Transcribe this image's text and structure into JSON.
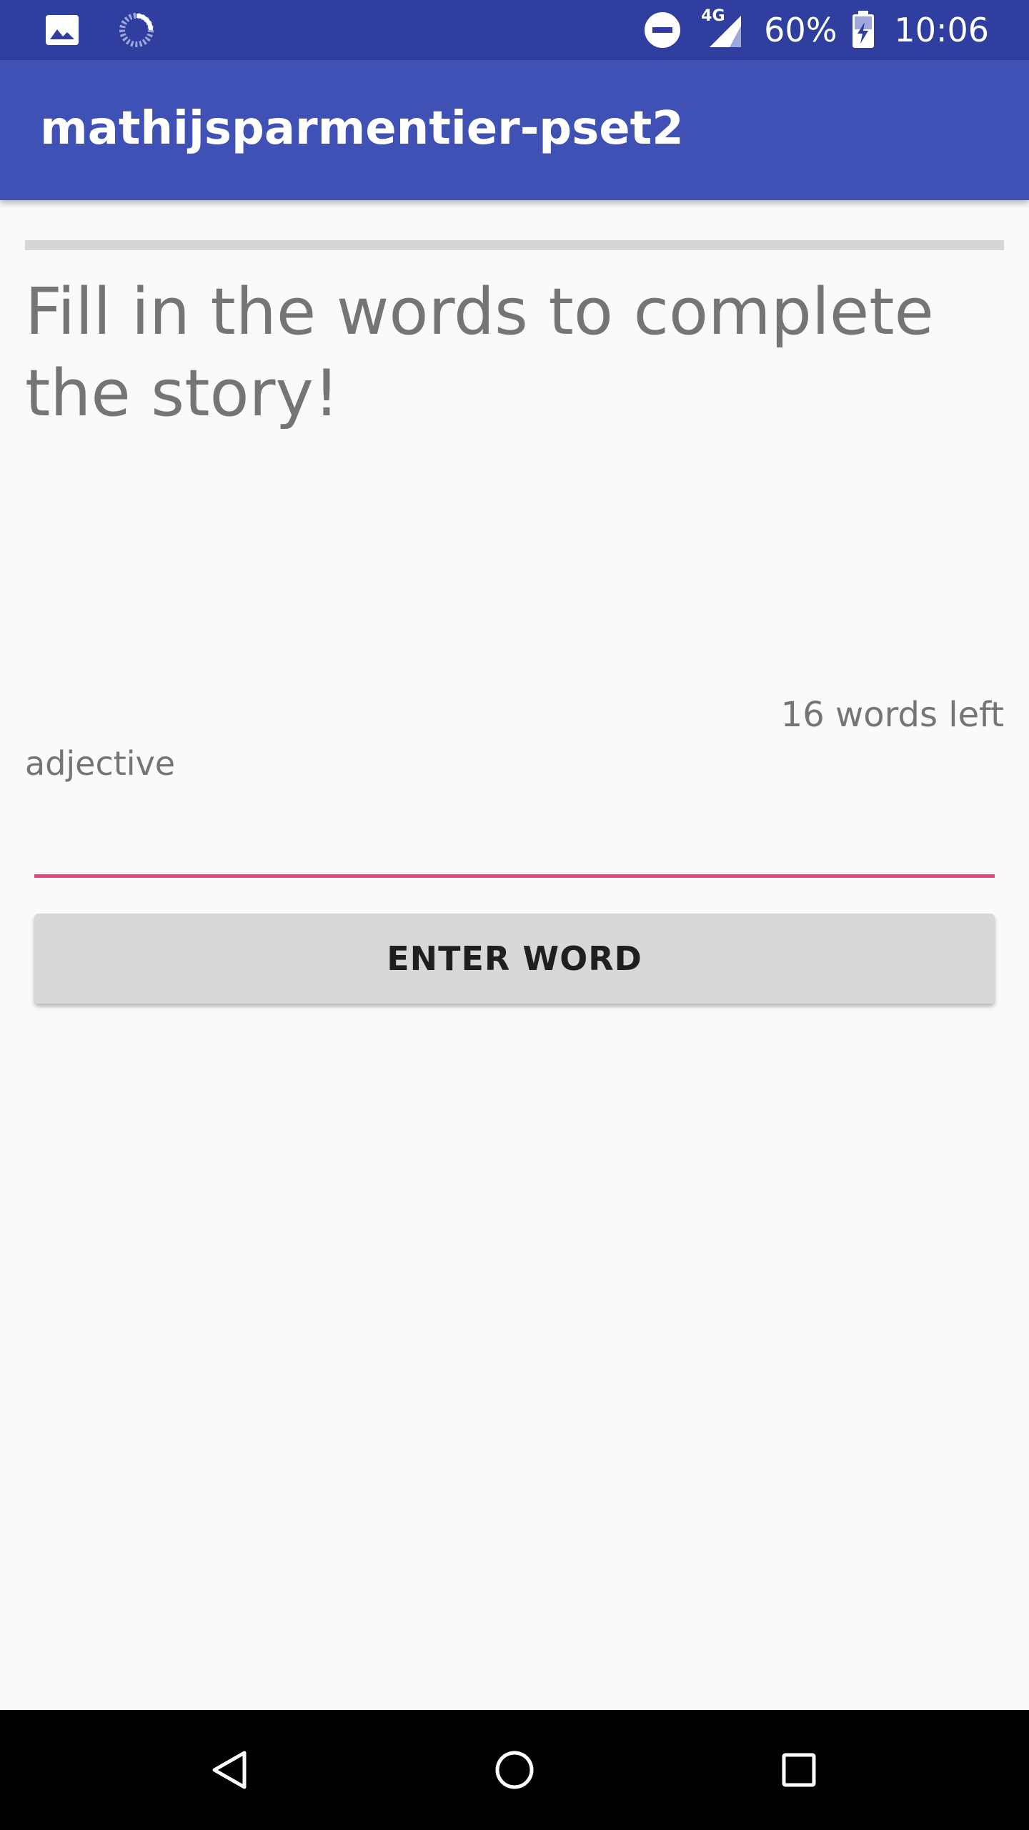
{
  "status_bar": {
    "battery_percent": "60%",
    "time": "10:06",
    "network_label": "4G",
    "icons": [
      "image-icon",
      "sync-icon",
      "do-not-disturb-icon",
      "signal-4g-icon",
      "battery-charging-icon"
    ],
    "background_color": "#303f9f"
  },
  "app_bar": {
    "title": "mathijsparmentier-pset2",
    "background_color": "#3f51b5"
  },
  "progress": {
    "value": 0
  },
  "main": {
    "heading": "Fill in the words to complete the story!",
    "words_left": "16 words left",
    "hint": "adjective",
    "input": {
      "value": "",
      "placeholder": ""
    },
    "enter_button_label": "ENTER WORD",
    "accent_color": "#e9457e"
  },
  "nav_bar": {
    "icons": [
      "back-icon",
      "home-icon",
      "recents-icon"
    ]
  }
}
